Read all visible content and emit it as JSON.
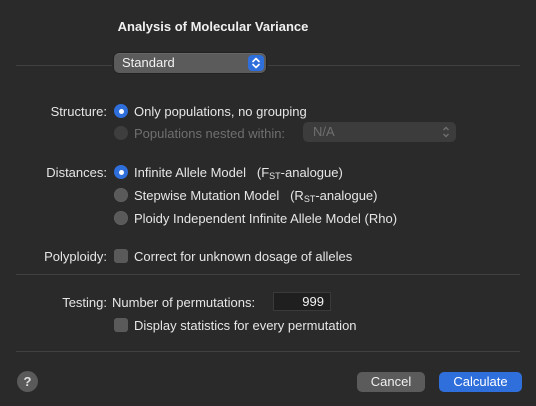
{
  "dialog": {
    "title": "Analysis of Molecular Variance",
    "mode_value": "Standard"
  },
  "structure": {
    "label": "Structure:",
    "option1": "Only populations, no grouping",
    "option2": "Populations nested within:",
    "nested_value": "N/A"
  },
  "distances": {
    "label": "Distances:",
    "opt1_main": "Infinite Allele Model",
    "opt1_stat": "F",
    "opt1_sub": "ST",
    "opt1_suffix": "-analogue)",
    "opt2_main": "Stepwise Mutation Model",
    "opt2_stat": "R",
    "opt2_sub": "ST",
    "opt2_suffix": "-analogue)",
    "opt3": "Ploidy Independent Infinite Allele Model (Rho)"
  },
  "polyploidy": {
    "label": "Polyploidy:",
    "checkbox": "Correct for unknown dosage of alleles"
  },
  "testing": {
    "label": "Testing:",
    "permutations_label": "Number of permutations:",
    "permutations_value": "999",
    "display_checkbox": "Display statistics for every permutation"
  },
  "footer": {
    "help": "?",
    "cancel": "Cancel",
    "calculate": "Calculate"
  }
}
